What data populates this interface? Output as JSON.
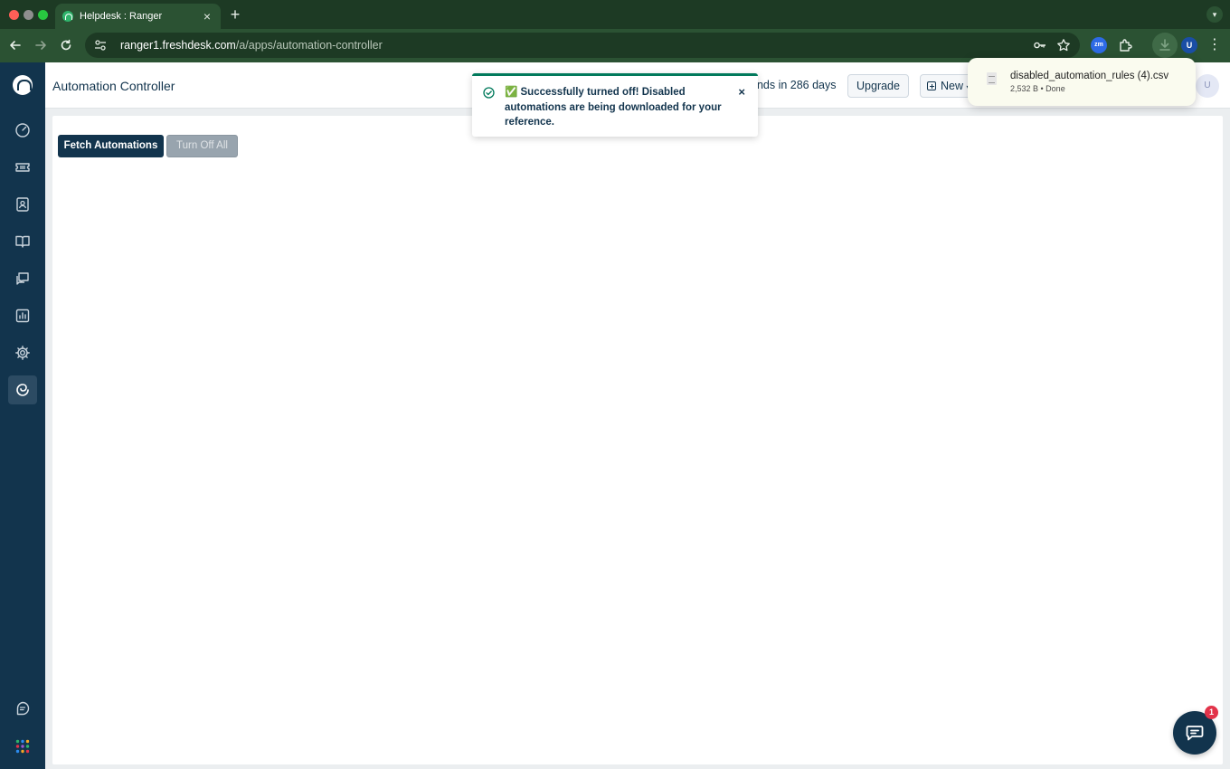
{
  "browser": {
    "tab_title": "Helpdesk : Ranger",
    "tab_close": "×",
    "new_tab": "+",
    "url_host": "ranger1.freshdesk.com",
    "url_path": "/a/apps/automation-controller",
    "profile_initial": "U",
    "zm_label": "zm",
    "download": {
      "file_name": "disabled_automation_rules (4).csv",
      "file_meta": "2,532 B • Done"
    }
  },
  "header": {
    "page_title": "Automation Controller",
    "trial_text": "ends in 286 days",
    "upgrade_label": "Upgrade",
    "new_label": "New",
    "avatar_initial": "U"
  },
  "main": {
    "fetch_label": "Fetch Automations",
    "turn_off_label": "Turn Off All"
  },
  "toast": {
    "message": "✅ Successfully turned off! Disabled automations are being downloaded for your reference.",
    "close": "×"
  },
  "chat": {
    "badge_count": "1"
  },
  "sidebar": {
    "items": [
      {
        "icon": "dashboard-icon"
      },
      {
        "icon": "tickets-icon"
      },
      {
        "icon": "contacts-icon"
      },
      {
        "icon": "solutions-icon"
      },
      {
        "icon": "forums-icon"
      },
      {
        "icon": "reports-icon"
      },
      {
        "icon": "admin-gear-icon"
      },
      {
        "icon": "automation-app-icon",
        "active": true
      },
      {
        "icon": "feedback-icon"
      },
      {
        "icon": "app-switcher-icon"
      }
    ]
  },
  "colors": {
    "sidebar_bg": "#12344d",
    "browser_frame": "#1d3a24",
    "toast_accent": "#00795b",
    "primary_button": "#12344d",
    "disabled_button": "#98a4ae",
    "badge": "#e2334a"
  }
}
